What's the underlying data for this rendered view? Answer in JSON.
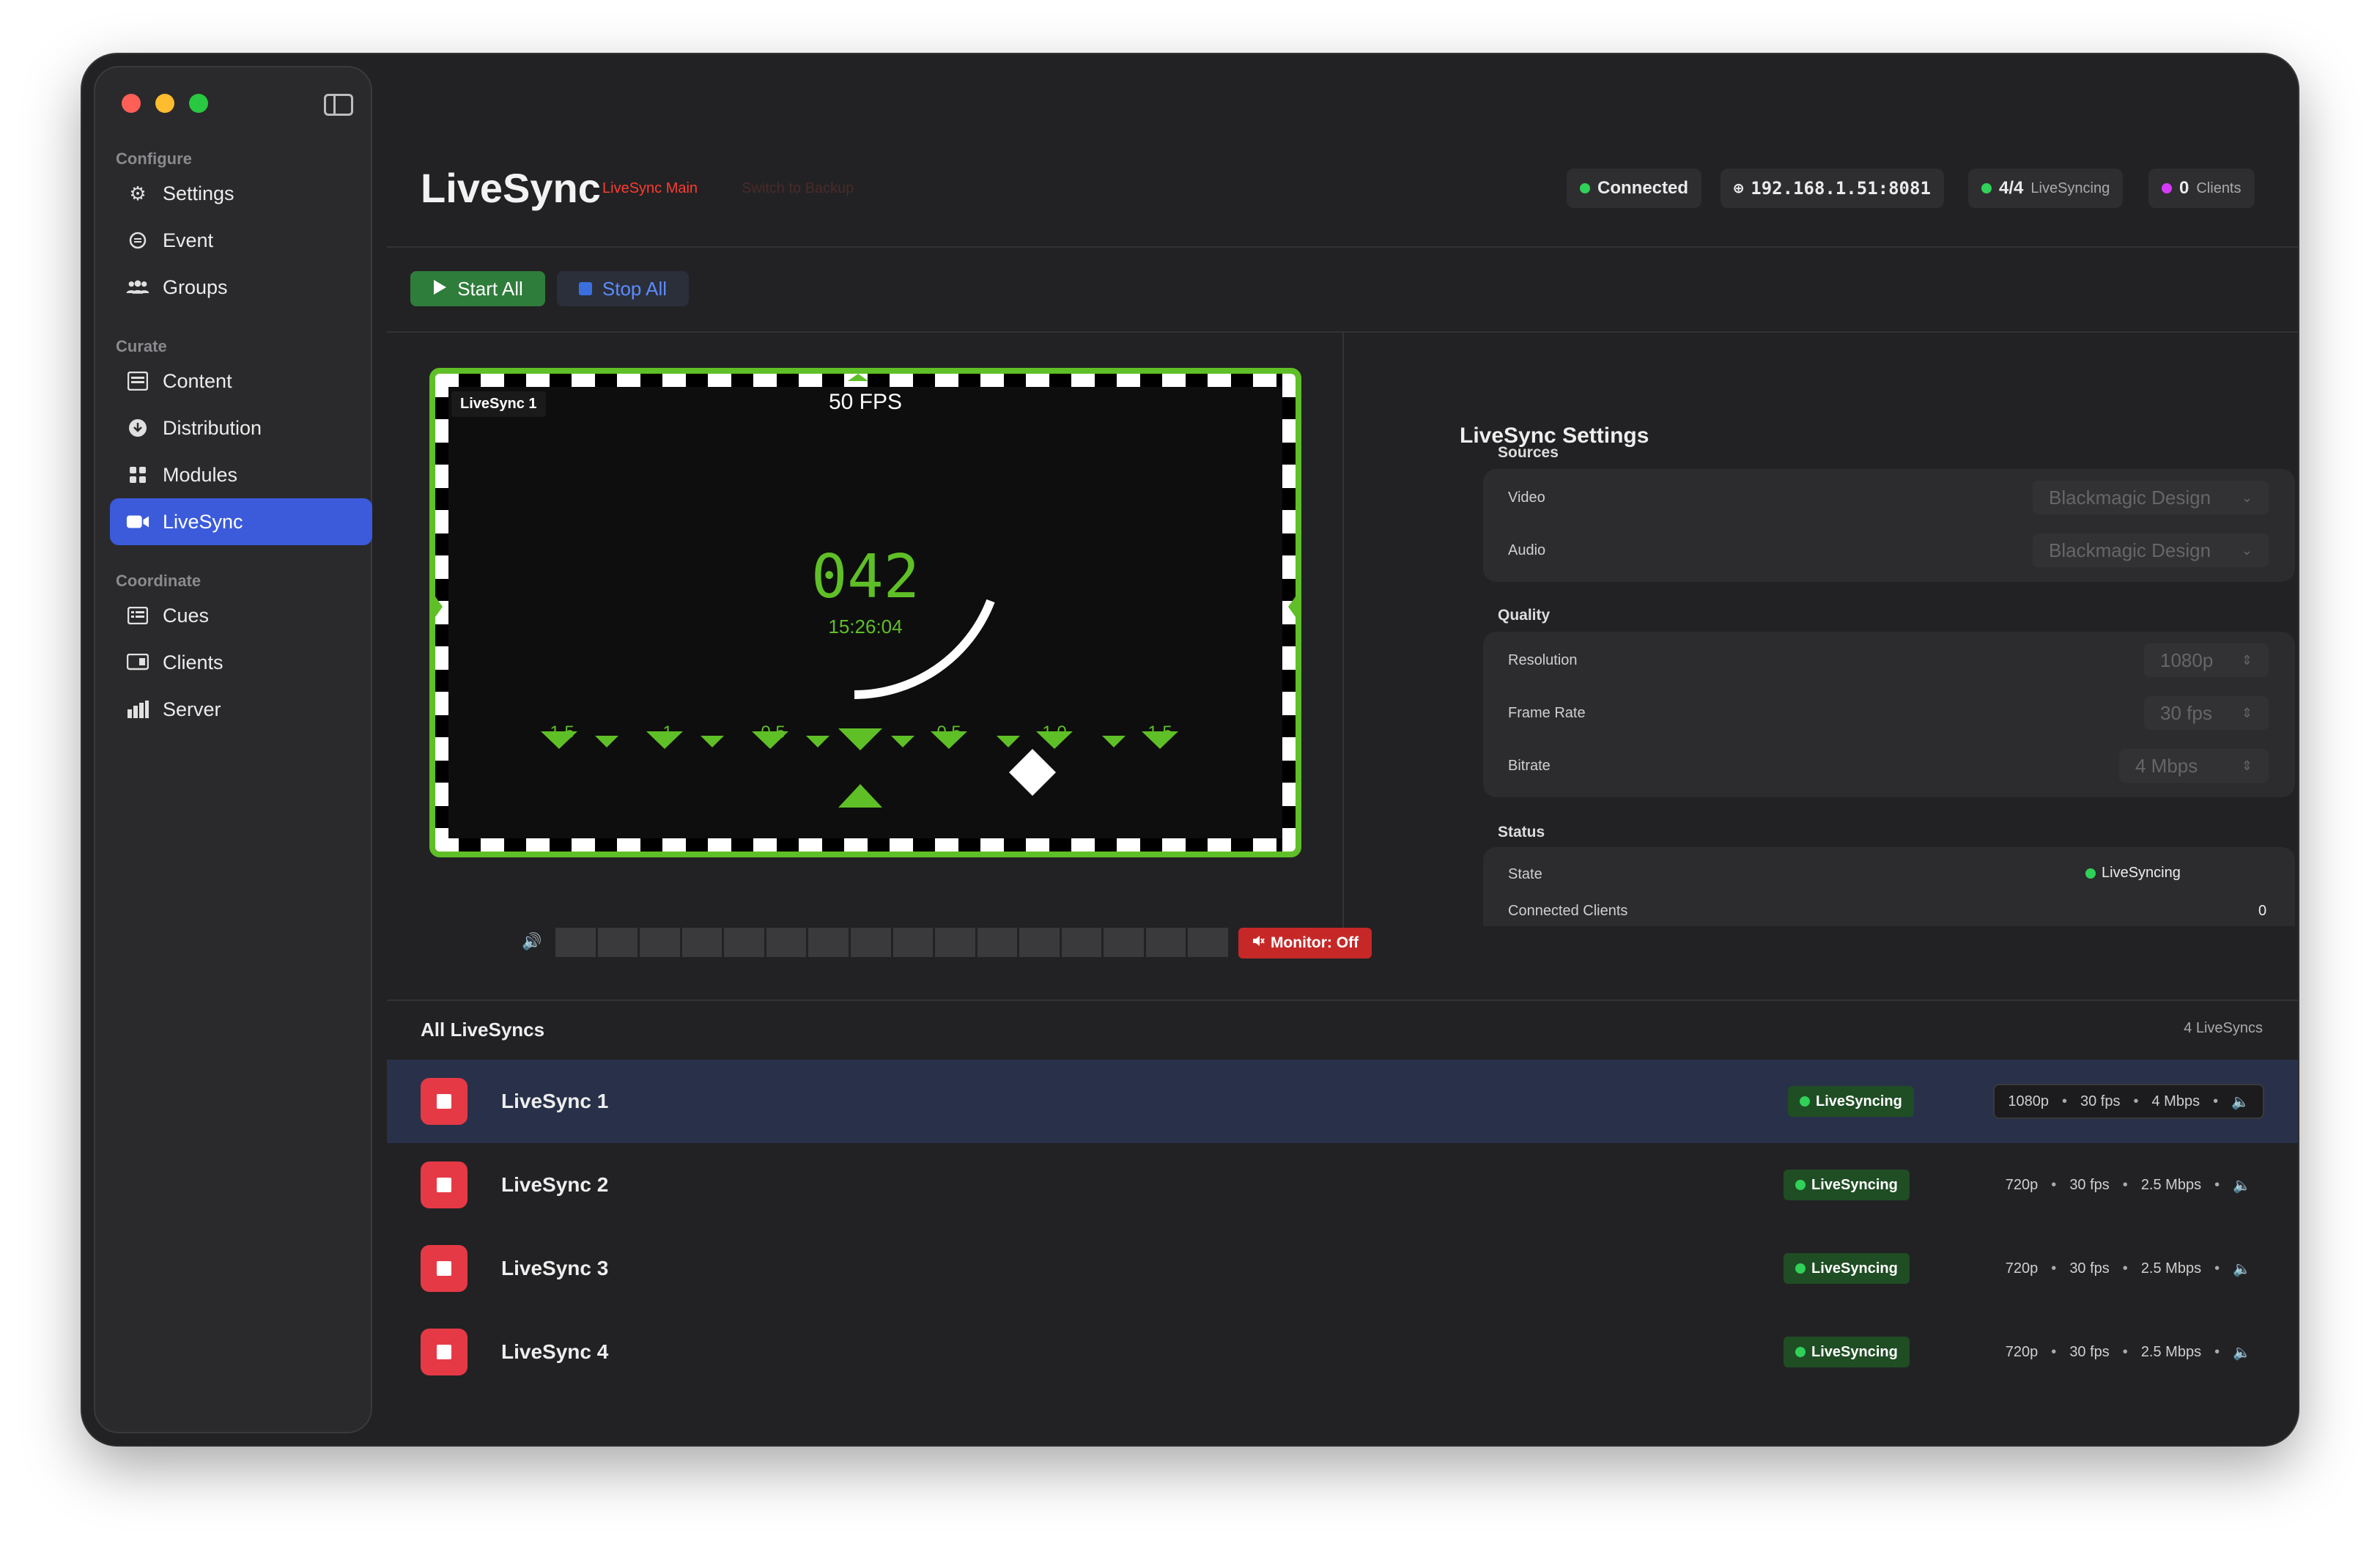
{
  "sidebar": {
    "sections": [
      {
        "label": "Configure",
        "items": [
          {
            "label": "Settings",
            "icon": "gear-icon"
          },
          {
            "label": "Event",
            "icon": "calendar-icon"
          },
          {
            "label": "Groups",
            "icon": "people-icon"
          }
        ]
      },
      {
        "label": "Curate",
        "items": [
          {
            "label": "Content",
            "icon": "film-icon"
          },
          {
            "label": "Distribution",
            "icon": "download-icon"
          },
          {
            "label": "Modules",
            "icon": "grid-icon"
          },
          {
            "label": "LiveSync",
            "icon": "video-camera-icon",
            "active": true
          }
        ]
      },
      {
        "label": "Coordinate",
        "items": [
          {
            "label": "Cues",
            "icon": "list-icon"
          },
          {
            "label": "Clients",
            "icon": "monitor-icon"
          },
          {
            "label": "Server",
            "icon": "bar-chart-icon"
          }
        ]
      }
    ]
  },
  "header": {
    "title": "LiveSync",
    "sub_label": "LiveSync Main",
    "switch_label": "Switch to Backup",
    "connection": "Connected",
    "address": "192.168.1.51:8081",
    "sync_count": "4/4",
    "sync_label": "LiveSyncing",
    "clients_count": "0",
    "clients_label": "Clients",
    "colors": {
      "connected": "#30d158",
      "clients": "#d63af9",
      "accent": "#3b5bdb"
    }
  },
  "toolbar": {
    "start_all": "Start All",
    "stop_all": "Stop All"
  },
  "preview": {
    "label": "LiveSync 1",
    "fps": "50 FPS",
    "frame": "042",
    "timecode": "15:26:04",
    "ticks": [
      "-1.5",
      "-1",
      "-0.5",
      "0.5",
      "1.0",
      "1.5"
    ],
    "monitor_button": "Monitor: Off",
    "meter_segments": 16
  },
  "settings": {
    "title": "LiveSync Settings",
    "sources": {
      "label": "Sources",
      "video_label": "Video",
      "video_value": "Blackmagic Design",
      "audio_label": "Audio",
      "audio_value": "Blackmagic Design"
    },
    "quality": {
      "label": "Quality",
      "resolution_label": "Resolution",
      "resolution_value": "1080p",
      "framerate_label": "Frame Rate",
      "framerate_value": "30 fps",
      "bitrate_label": "Bitrate",
      "bitrate_value": "4 Mbps"
    },
    "status": {
      "label": "Status",
      "state_label": "State",
      "state_value": "LiveSyncing",
      "clients_label": "Connected Clients",
      "clients_value": "0"
    }
  },
  "list": {
    "title": "All LiveSyncs",
    "count": "4 LiveSyncs",
    "rows": [
      {
        "name": "LiveSync 1",
        "status": "LiveSyncing",
        "res": "1080p",
        "fps": "30 fps",
        "bitrate": "4 Mbps",
        "selected": true
      },
      {
        "name": "LiveSync 2",
        "status": "LiveSyncing",
        "res": "720p",
        "fps": "30 fps",
        "bitrate": "2.5 Mbps"
      },
      {
        "name": "LiveSync 3",
        "status": "LiveSyncing",
        "res": "720p",
        "fps": "30 fps",
        "bitrate": "2.5 Mbps"
      },
      {
        "name": "LiveSync 4",
        "status": "LiveSyncing",
        "res": "720p",
        "fps": "30 fps",
        "bitrate": "2.5 Mbps"
      }
    ]
  }
}
